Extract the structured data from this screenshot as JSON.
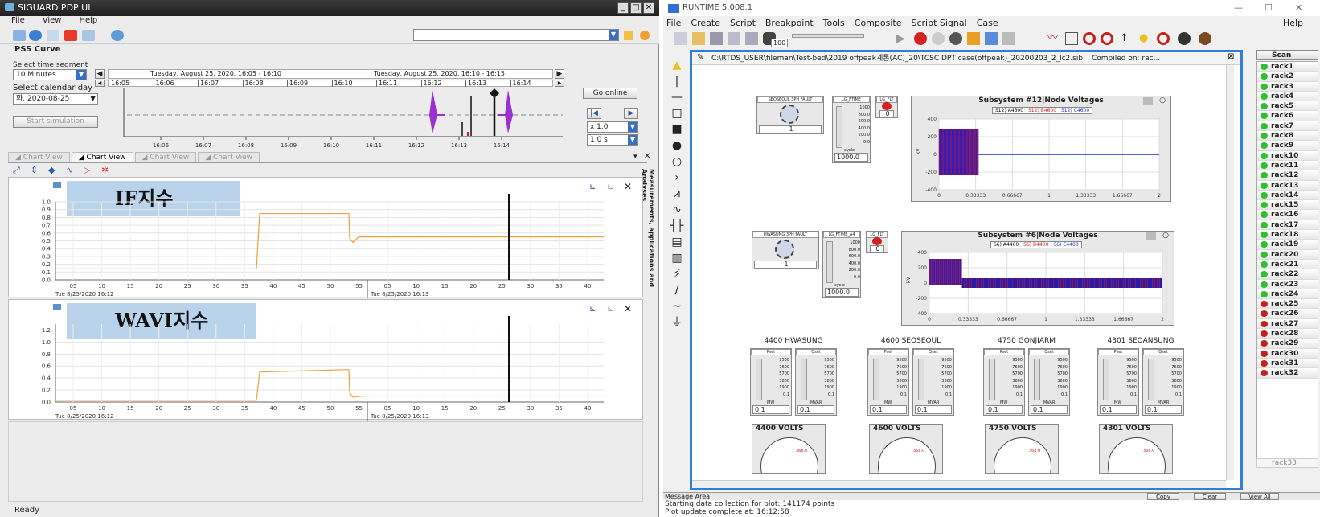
{
  "left": {
    "title": "SIGUARD PDP UI",
    "menu": [
      "File",
      "View",
      "Help"
    ],
    "section": "PSS Curve",
    "time_segment_label": "Select time segment",
    "time_segment_value": "10 Minutes",
    "calendar_label": "Select calendar day",
    "calendar_value": "화, 2020-08-25",
    "start_simulation": "Start simulation",
    "go_online": "Go online",
    "zoom_value": "x 1.0",
    "step_value": "1.0 s",
    "range1": "Tuesday, August 25, 2020, 16:05 - 16:10",
    "range2": "Tuesday, August 25, 2020, 16:10 - 16:15",
    "top_ticks": [
      "16:05",
      "16:06",
      "16:07",
      "16:08",
      "16:09",
      "16:10",
      "16:11",
      "16:12",
      "16:13",
      "16:14"
    ],
    "overview_ticks": [
      "16:06",
      "16:07",
      "16:08",
      "16:09",
      "16:10",
      "16:11",
      "16:12",
      "16:13",
      "16:14"
    ],
    "tabs": [
      "Chart View",
      "Chart View",
      "Chart View",
      "Chart View"
    ],
    "side_label": "Measurements, applications and Analyses",
    "status": "Ready",
    "chart1": {
      "banner": "IF지수",
      "yticks": [
        "1.0",
        "0.9",
        "0.8",
        "0.7",
        "0.6",
        "0.5",
        "0.4",
        "0.3",
        "0.2",
        "0.1",
        "0.0"
      ]
    },
    "chart2": {
      "banner": "WAVI지수",
      "yticks": [
        "1.2",
        "1.0",
        "0.8",
        "0.6",
        "0.4",
        "0.2",
        "0.0"
      ]
    },
    "xticks": [
      "05",
      "10",
      "15",
      "20",
      "25",
      "30",
      "35",
      "40",
      "45",
      "50",
      "55",
      "05",
      "10",
      "15",
      "20",
      "25",
      "30",
      "35",
      "40"
    ],
    "xdate1": "Tue 8/25/2020 16:12",
    "xdate2": "Tue 8/25/2020 16:13"
  },
  "right": {
    "title": "RUNTIME 5.008.1",
    "menu": [
      "File",
      "Create",
      "Script",
      "Breakpoint",
      "Tools",
      "Composite",
      "Script Signal",
      "Case"
    ],
    "help": "Help",
    "toolbar_value": "100",
    "case_path": "C:\\RTDS_USER\\fileman\\Test-bed\\2019 offpeak계통(AC)_20\\TCSC DPT case(offpeak)_20200203_2_lc2.sib",
    "compiled": "Compiled on: rac...",
    "subsystem1": {
      "fault_title": "SEOSEOUL 3PH FAULT",
      "fault_val": "1",
      "ftime_title": "LG_FTIME",
      "flt_title": "LG_FLT",
      "flt_val": "0",
      "cycle_val": "1000.0",
      "plot_title": "Subsystem #12|Node Voltages",
      "legend": [
        "S12) A4600",
        "S12) B4600",
        "S12) C4600"
      ]
    },
    "subsystem2": {
      "fault_title": "HWASUNG 3PH FAULT",
      "fault_val": "1",
      "ftime_title": "LG_FTIME_A4",
      "flt_title": "LG_FLT",
      "flt_val": "0",
      "cycle_val": "1000.0",
      "plot_title": "Subsystem #6|Node Voltages",
      "legend": [
        "S6) A4400",
        "S6) B4400",
        "S6) C4400"
      ]
    },
    "slider_ticks": [
      "1000",
      "800.0",
      "600.0",
      "400.0",
      "200.0",
      "0.0"
    ],
    "cycle_label": "cycle",
    "plot_yticks": [
      "400",
      "200",
      "0",
      "-200",
      "-400"
    ],
    "plot_xticks": [
      "0",
      "0.33333",
      "0.66667",
      "1",
      "1.33333",
      "1.66667",
      "2"
    ],
    "plot_ylabel": "kV",
    "buses": [
      {
        "name": "4400 HWASUNG",
        "volts": "4400 VOLTS"
      },
      {
        "name": "4600 SEOSEOUL",
        "volts": "4600 VOLTS"
      },
      {
        "name": "4750 GONJIARM",
        "volts": "4750 VOLTS"
      },
      {
        "name": "4301 SEOANSUNG",
        "volts": "4301 VOLTS"
      }
    ],
    "pset": "Pset",
    "qset": "Qset",
    "mw": "MW",
    "mvar": "MVAR",
    "bus_val": "0.1",
    "bus_ticks": [
      "9500",
      "7600",
      "5700",
      "3800",
      "1900",
      "0.1"
    ],
    "gauge_max": "368.0",
    "scan": "Scan",
    "racks": [
      {
        "n": "rack1",
        "c": "#2fbf2f"
      },
      {
        "n": "rack2",
        "c": "#2fbf2f"
      },
      {
        "n": "rack3",
        "c": "#2fbf2f"
      },
      {
        "n": "rack4",
        "c": "#2fbf2f"
      },
      {
        "n": "rack5",
        "c": "#2fbf2f"
      },
      {
        "n": "rack6",
        "c": "#2fbf2f"
      },
      {
        "n": "rack7",
        "c": "#2fbf2f"
      },
      {
        "n": "rack8",
        "c": "#2fbf2f"
      },
      {
        "n": "rack9",
        "c": "#2fbf2f"
      },
      {
        "n": "rack10",
        "c": "#2fbf2f"
      },
      {
        "n": "rack11",
        "c": "#2fbf2f"
      },
      {
        "n": "rack12",
        "c": "#2fbf2f"
      },
      {
        "n": "rack13",
        "c": "#2fbf2f"
      },
      {
        "n": "rack14",
        "c": "#2fbf2f"
      },
      {
        "n": "rack15",
        "c": "#2fbf2f"
      },
      {
        "n": "rack16",
        "c": "#2fbf2f"
      },
      {
        "n": "rack17",
        "c": "#2fbf2f"
      },
      {
        "n": "rack18",
        "c": "#2fbf2f"
      },
      {
        "n": "rack19",
        "c": "#2fbf2f"
      },
      {
        "n": "rack20",
        "c": "#2fbf2f"
      },
      {
        "n": "rack21",
        "c": "#2fbf2f"
      },
      {
        "n": "rack22",
        "c": "#2fbf2f"
      },
      {
        "n": "rack23",
        "c": "#2fbf2f"
      },
      {
        "n": "rack24",
        "c": "#2fbf2f"
      },
      {
        "n": "rack25",
        "c": "#c4201c"
      },
      {
        "n": "rack26",
        "c": "#c4201c"
      },
      {
        "n": "rack27",
        "c": "#c4201c"
      },
      {
        "n": "rack28",
        "c": "#c4201c"
      },
      {
        "n": "rack29",
        "c": "#c4201c"
      },
      {
        "n": "rack30",
        "c": "#c4201c"
      },
      {
        "n": "rack31",
        "c": "#c4201c"
      },
      {
        "n": "rack32",
        "c": "#c4201c"
      }
    ],
    "rack33": "rack33",
    "message_area": "Message Area",
    "copy": "Copy",
    "clear": "Clear",
    "view_all": "View All",
    "messages": [
      "Starting data collection for plot: 141174 points",
      "Plot update complete at: 16:12:58"
    ]
  },
  "colors": {
    "accent": "#2f7fd6",
    "orange": "#f0a040",
    "purple": "#9b30d0",
    "blue": "#1a2fcc",
    "red": "#d42020",
    "green": "#2fbf2f"
  }
}
